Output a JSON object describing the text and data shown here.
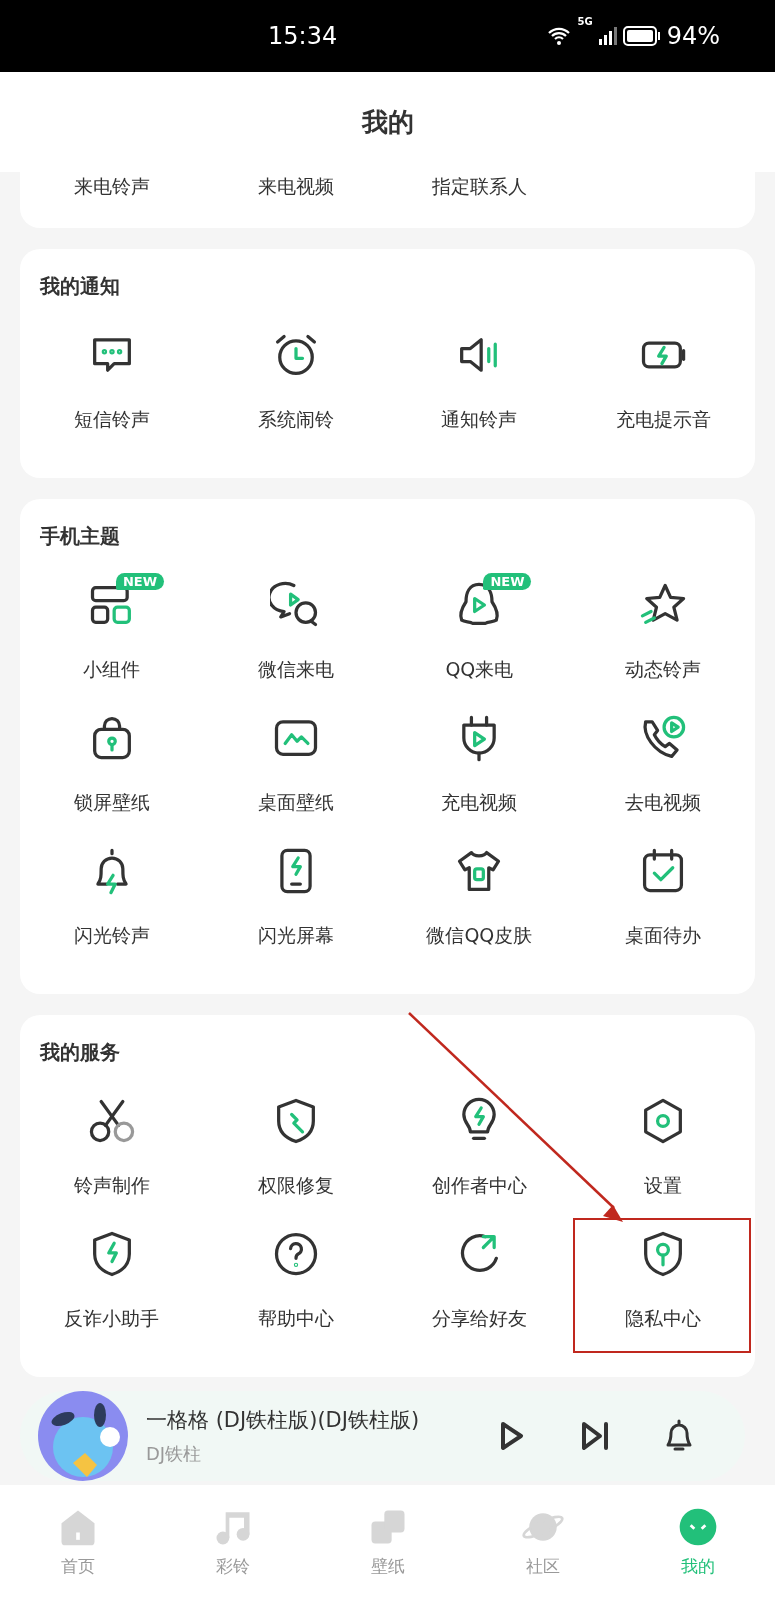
{
  "status_bar": {
    "time": "15:34",
    "network": "5G",
    "battery": "94%"
  },
  "header": {
    "title": "我的"
  },
  "top_card": {
    "items": [
      "来电铃声",
      "来电视频",
      "指定联系人"
    ]
  },
  "sections": [
    {
      "title": "我的通知",
      "items": [
        {
          "label": "短信铃声",
          "highlighted": false
        },
        {
          "label": "系统闹铃",
          "highlighted": false
        },
        {
          "label": "通知铃声",
          "highlighted": false
        },
        {
          "label": "充电提示音",
          "highlighted": false
        }
      ]
    },
    {
      "title": "手机主题",
      "items": [
        {
          "label": "小组件",
          "badge": "NEW",
          "highlighted": false
        },
        {
          "label": "微信来电",
          "highlighted": false
        },
        {
          "label": "QQ来电",
          "badge": "NEW",
          "highlighted": false
        },
        {
          "label": "动态铃声",
          "highlighted": false
        },
        {
          "label": "锁屏壁纸",
          "highlighted": false
        },
        {
          "label": "桌面壁纸",
          "highlighted": false
        },
        {
          "label": "充电视频",
          "highlighted": false
        },
        {
          "label": "去电视频",
          "highlighted": false
        },
        {
          "label": "闪光铃声",
          "highlighted": false
        },
        {
          "label": "闪光屏幕",
          "highlighted": false
        },
        {
          "label": "微信QQ皮肤",
          "highlighted": false
        },
        {
          "label": "桌面待办",
          "highlighted": false
        }
      ]
    },
    {
      "title": "我的服务",
      "items": [
        {
          "label": "铃声制作",
          "highlighted": false
        },
        {
          "label": "权限修复",
          "highlighted": false
        },
        {
          "label": "创作者中心",
          "highlighted": false
        },
        {
          "label": "设置",
          "highlighted": false
        },
        {
          "label": "反诈小助手",
          "highlighted": false
        },
        {
          "label": "帮助中心",
          "highlighted": false
        },
        {
          "label": "分享给好友",
          "highlighted": false
        },
        {
          "label": "隐私中心",
          "highlighted": true
        }
      ]
    }
  ],
  "player": {
    "title": "一格格 (DJ铁柱版)(DJ铁柱版)",
    "artist": "DJ铁柱"
  },
  "bottom_nav": [
    {
      "label": "首页",
      "selected": false
    },
    {
      "label": "彩铃",
      "selected": false
    },
    {
      "label": "壁纸",
      "selected": false
    },
    {
      "label": "社区",
      "selected": false
    },
    {
      "label": "我的",
      "selected": true
    }
  ]
}
